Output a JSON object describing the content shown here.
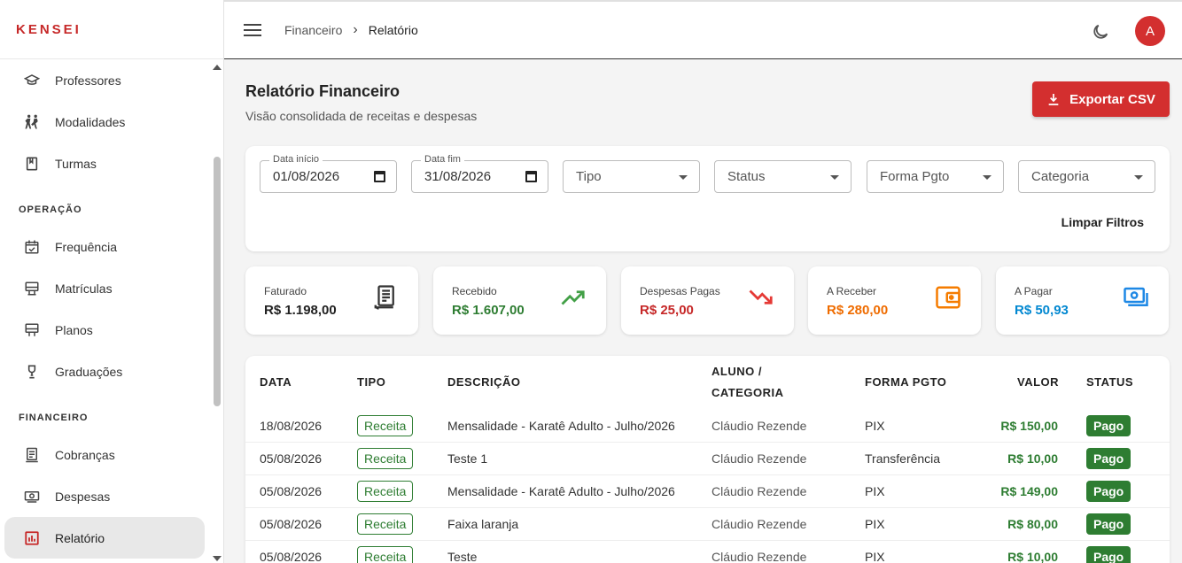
{
  "brand": "KENSEI",
  "sidebar": {
    "items": [
      {
        "label": "Professores",
        "icon": "graduation-cap-icon"
      },
      {
        "label": "Modalidades",
        "icon": "martial-arts-icon"
      },
      {
        "label": "Turmas",
        "icon": "book-icon"
      },
      {
        "section": "OPERAÇÃO"
      },
      {
        "label": "Frequência",
        "icon": "calendar-check-icon"
      },
      {
        "label": "Matrículas",
        "icon": "enrollment-icon"
      },
      {
        "label": "Planos",
        "icon": "plans-icon"
      },
      {
        "label": "Graduações",
        "icon": "medal-icon"
      },
      {
        "section": "FINANCEIRO"
      },
      {
        "label": "Cobranças",
        "icon": "receipt-icon"
      },
      {
        "label": "Despesas",
        "icon": "cash-icon"
      },
      {
        "label": "Relatório",
        "icon": "bar-chart-icon",
        "active": true
      }
    ]
  },
  "header": {
    "breadcrumb": [
      "Financeiro",
      "Relatório"
    ],
    "avatar_letter": "A"
  },
  "page": {
    "title": "Relatório Financeiro",
    "subtitle": "Visão consolidada de receitas e despesas",
    "export_label": "Exportar CSV"
  },
  "filters": {
    "start_label": "Data início",
    "start_value": "01/08/2026",
    "end_label": "Data fim",
    "end_value": "31/08/2026",
    "tipo": "Tipo",
    "status": "Status",
    "forma": "Forma Pgto",
    "categoria": "Categoria",
    "clear_label": "Limpar Filtros"
  },
  "kpis": [
    {
      "label": "Faturado",
      "value": "R$ 1.198,00",
      "color": "#222222",
      "icon": "receipt-icon"
    },
    {
      "label": "Recebido",
      "value": "R$ 1.607,00",
      "color": "#2e7d32",
      "icon": "trending-up-icon"
    },
    {
      "label": "Despesas Pagas",
      "value": "R$ 25,00",
      "color": "#c62828",
      "icon": "trending-down-icon"
    },
    {
      "label": "A Receber",
      "value": "R$ 280,00",
      "color": "#ef6c00",
      "icon": "wallet-icon"
    },
    {
      "label": "A Pagar",
      "value": "R$ 50,93",
      "color": "#0288d1",
      "icon": "money-icon"
    }
  ],
  "table": {
    "headers": {
      "data": "DATA",
      "tipo": "TIPO",
      "descricao": "DESCRIÇÃO",
      "aluno1": "ALUNO /",
      "aluno2": "CATEGORIA",
      "forma": "FORMA PGTO",
      "valor": "VALOR",
      "status": "STATUS"
    },
    "rows": [
      {
        "data": "18/08/2026",
        "tipo": "Receita",
        "descricao": "Mensalidade - Karatê Adulto - Julho/2026",
        "aluno": "Cláudio Rezende",
        "forma": "PIX",
        "valor": "R$ 150,00",
        "status": "Pago"
      },
      {
        "data": "05/08/2026",
        "tipo": "Receita",
        "descricao": "Teste 1",
        "aluno": "Cláudio Rezende",
        "forma": "Transferência",
        "valor": "R$ 10,00",
        "status": "Pago"
      },
      {
        "data": "05/08/2026",
        "tipo": "Receita",
        "descricao": "Mensalidade - Karatê Adulto - Julho/2026",
        "aluno": "Cláudio Rezende",
        "forma": "PIX",
        "valor": "R$ 149,00",
        "status": "Pago"
      },
      {
        "data": "05/08/2026",
        "tipo": "Receita",
        "descricao": "Faixa laranja",
        "aluno": "Cláudio Rezende",
        "forma": "PIX",
        "valor": "R$ 80,00",
        "status": "Pago"
      },
      {
        "data": "05/08/2026",
        "tipo": "Receita",
        "descricao": "Teste",
        "aluno": "Cláudio Rezende",
        "forma": "PIX",
        "valor": "R$ 10,00",
        "status": "Pago"
      }
    ]
  },
  "colors": {
    "accent": "#d32f2f",
    "success": "#2e7d32"
  }
}
